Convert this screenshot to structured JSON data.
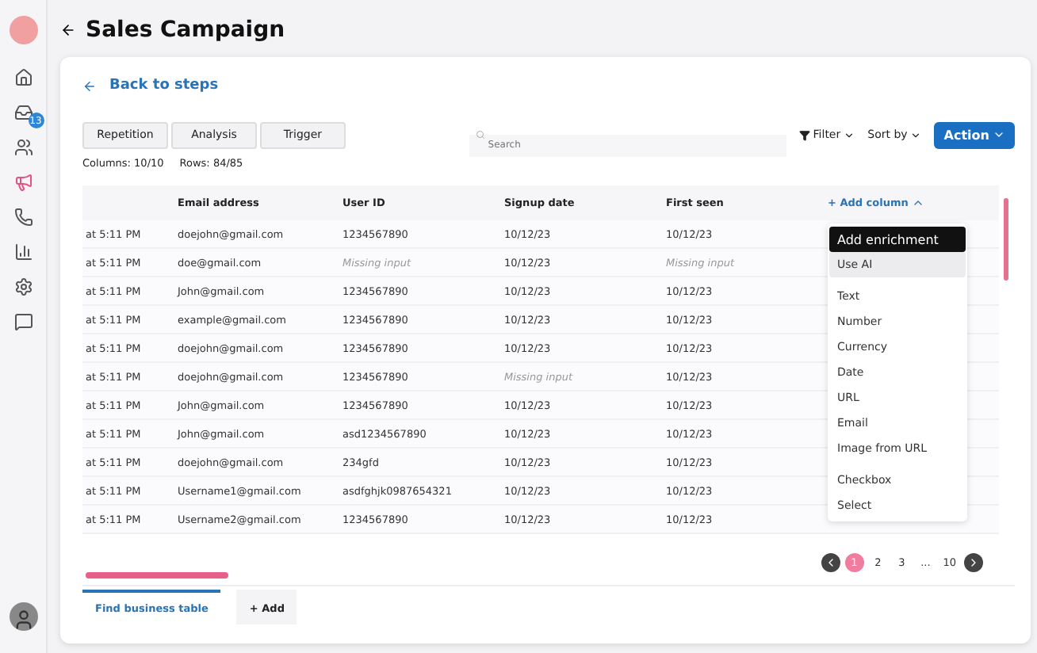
{
  "sidebar": {
    "items": [
      {
        "selected": false
      },
      {
        "selected": false,
        "badge": "13"
      },
      {
        "selected": false
      },
      {
        "selected": true
      },
      {
        "selected": false
      },
      {
        "selected": false
      },
      {
        "selected": false
      },
      {
        "selected": false
      }
    ]
  },
  "title": "Sales Campaign",
  "back_link": "Back to steps",
  "tabs": [
    {
      "label": "Repetition",
      "selected": false
    },
    {
      "label": "Analysis",
      "selected": false
    },
    {
      "label": "Trigger",
      "selected": false
    }
  ],
  "search": {
    "placeholder": "Search"
  },
  "filter": "Filter",
  "sort": "Sort by",
  "action": "Action",
  "stats": {
    "columns_label": "Columns:",
    "columns": "10/10",
    "rows_label": "Rows:",
    "rows": "84/85"
  },
  "table": {
    "columns": [
      "",
      "Email address",
      "User ID",
      "Signup date",
      "First seen"
    ],
    "add_column": "+ Add column",
    "rows": [
      {
        "cells": [
          {
            "text": "at 5:11 PM",
            "kind": "value"
          },
          {
            "text": "doejohn@gmail.com",
            "kind": "value"
          },
          {
            "text": "1234567890",
            "kind": "value"
          },
          {
            "text": "10/12/23",
            "kind": "value"
          },
          {
            "text": "10/12/23",
            "kind": "value"
          }
        ]
      },
      {
        "cells": [
          {
            "text": "at 5:11 PM",
            "kind": "value"
          },
          {
            "text": "doe@gmail.com",
            "kind": "value"
          },
          {
            "text": "Missing input",
            "kind": "missing"
          },
          {
            "text": "10/12/23",
            "kind": "value"
          },
          {
            "text": "Missing input",
            "kind": "missing"
          }
        ]
      },
      {
        "cells": [
          {
            "text": "at 5:11 PM",
            "kind": "value"
          },
          {
            "text": "John@gmail.com",
            "kind": "value"
          },
          {
            "text": "1234567890",
            "kind": "value"
          },
          {
            "text": "10/12/23",
            "kind": "value"
          },
          {
            "text": "10/12/23",
            "kind": "value"
          }
        ]
      },
      {
        "cells": [
          {
            "text": "at 5:11 PM",
            "kind": "value"
          },
          {
            "text": "example@gmail.com",
            "kind": "value"
          },
          {
            "text": "1234567890",
            "kind": "value"
          },
          {
            "text": "10/12/23",
            "kind": "value"
          },
          {
            "text": "10/12/23",
            "kind": "value"
          }
        ]
      },
      {
        "cells": [
          {
            "text": "at 5:11 PM",
            "kind": "value"
          },
          {
            "text": "doejohn@gmail.com",
            "kind": "value"
          },
          {
            "text": "1234567890",
            "kind": "value"
          },
          {
            "text": "10/12/23",
            "kind": "value"
          },
          {
            "text": "10/12/23",
            "kind": "value"
          }
        ]
      },
      {
        "cells": [
          {
            "text": "at 5:11 PM",
            "kind": "value"
          },
          {
            "text": "doejohn@gmail.com",
            "kind": "value"
          },
          {
            "text": "1234567890",
            "kind": "value"
          },
          {
            "text": "Missing input",
            "kind": "missing"
          },
          {
            "text": "10/12/23",
            "kind": "value"
          }
        ]
      },
      {
        "cells": [
          {
            "text": "at 5:11 PM",
            "kind": "value"
          },
          {
            "text": "John@gmail.com",
            "kind": "value"
          },
          {
            "text": "1234567890",
            "kind": "value"
          },
          {
            "text": "10/12/23",
            "kind": "value"
          },
          {
            "text": "10/12/23",
            "kind": "value"
          }
        ]
      },
      {
        "cells": [
          {
            "text": "at 5:11 PM",
            "kind": "value"
          },
          {
            "text": "John@gmail.com",
            "kind": "value"
          },
          {
            "text": "asd1234567890",
            "kind": "value"
          },
          {
            "text": "10/12/23",
            "kind": "value"
          },
          {
            "text": "10/12/23",
            "kind": "value"
          }
        ]
      },
      {
        "cells": [
          {
            "text": "at 5:11 PM",
            "kind": "value"
          },
          {
            "text": "doejohn@gmail.com",
            "kind": "value"
          },
          {
            "text": "234gfd",
            "kind": "value"
          },
          {
            "text": "10/12/23",
            "kind": "value"
          },
          {
            "text": "10/12/23",
            "kind": "value"
          }
        ]
      },
      {
        "cells": [
          {
            "text": "at 5:11 PM",
            "kind": "value"
          },
          {
            "text": "Username1@gmail.com",
            "kind": "value"
          },
          {
            "text": "asdfghjk0987654321",
            "kind": "value"
          },
          {
            "text": "10/12/23",
            "kind": "value"
          },
          {
            "text": "10/12/23",
            "kind": "value"
          }
        ]
      },
      {
        "cells": [
          {
            "text": "at 5:11 PM",
            "kind": "value"
          },
          {
            "text": "Username2@gmail.com",
            "kind": "value"
          },
          {
            "text": "1234567890",
            "kind": "value"
          },
          {
            "text": "10/12/23",
            "kind": "value"
          },
          {
            "text": "10/12/23",
            "kind": "value"
          }
        ]
      }
    ]
  },
  "column_menu": {
    "groups": [
      [
        {
          "label": "Add enrichment",
          "kind": "primary"
        },
        {
          "label": "Use AI",
          "kind": "ai"
        }
      ],
      [
        {
          "label": "Text",
          "kind": "type"
        },
        {
          "label": "Number",
          "kind": "type"
        },
        {
          "label": "Currency",
          "kind": "type"
        },
        {
          "label": "Date",
          "kind": "type"
        },
        {
          "label": "URL",
          "kind": "type"
        },
        {
          "label": "Email",
          "kind": "type"
        },
        {
          "label": "Image from URL",
          "kind": "type"
        }
      ],
      [
        {
          "label": "Checkbox",
          "kind": "type"
        },
        {
          "label": "Select",
          "kind": "type"
        }
      ]
    ]
  },
  "pagination": {
    "pages": [
      {
        "label": "1",
        "selected": true
      },
      {
        "label": "2",
        "selected": false
      },
      {
        "label": "3",
        "selected": false
      },
      {
        "label": "...",
        "selected": false
      },
      {
        "label": "10",
        "selected": false
      }
    ]
  },
  "bottom_tabs": [
    {
      "label": "Find business table",
      "selected": true
    },
    {
      "label": "+ Add",
      "selected": false
    }
  ]
}
